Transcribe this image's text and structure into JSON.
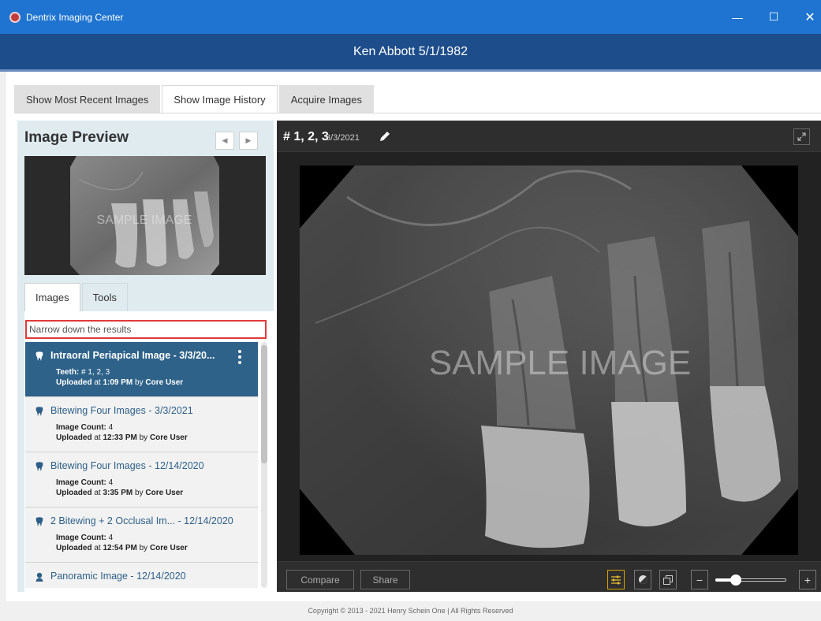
{
  "window": {
    "title": "Dentrix Imaging Center",
    "minimize": "—",
    "maximize": "☐",
    "close": "✕"
  },
  "patient": {
    "header": "Ken Abbott 5/1/1982"
  },
  "main_tabs": [
    {
      "label": "Show Most Recent Images",
      "active": false
    },
    {
      "label": "Show Image History",
      "active": true
    },
    {
      "label": "Acquire Images",
      "active": false
    }
  ],
  "preview": {
    "title": "Image Preview",
    "prev": "◀",
    "next": "▶",
    "watermark": "SAMPLE IMAGE"
  },
  "side_tabs": [
    {
      "label": "Images",
      "active": true
    },
    {
      "label": "Tools",
      "active": false
    }
  ],
  "filter": {
    "placeholder": "Narrow down the results",
    "value": ""
  },
  "results": [
    {
      "title": "Intraoral Periapical Image - 3/3/20...",
      "line1_label": "Teeth:",
      "line1_value": " # 1, 2, 3",
      "line2_label": "Uploaded",
      "line2_mid": " at ",
      "line2_time": "1:09 PM",
      "line2_by": " by ",
      "line2_user": "Core User",
      "selected": true,
      "icon": "tooth-icon"
    },
    {
      "title": "Bitewing Four Images - 3/3/2021",
      "line1_label": "Image Count:",
      "line1_value": " 4",
      "line2_label": "Uploaded",
      "line2_mid": " at ",
      "line2_time": "12:33 PM",
      "line2_by": " by ",
      "line2_user": "Core User",
      "selected": false,
      "icon": "tooth-icon"
    },
    {
      "title": "Bitewing Four Images - 12/14/2020",
      "line1_label": "Image Count:",
      "line1_value": " 4",
      "line2_label": "Uploaded",
      "line2_mid": " at ",
      "line2_time": "3:35 PM",
      "line2_by": " by ",
      "line2_user": "Core User",
      "selected": false,
      "icon": "tooth-icon"
    },
    {
      "title": "2 Bitewing + 2 Occlusal Im... - 12/14/2020",
      "line1_label": "Image Count:",
      "line1_value": " 4",
      "line2_label": "Uploaded",
      "line2_mid": " at ",
      "line2_time": "12:54 PM",
      "line2_by": " by ",
      "line2_user": "Core User",
      "selected": false,
      "icon": "tooth-icon"
    },
    {
      "title": "Panoramic Image - 12/14/2020",
      "line1_label": "",
      "line1_value": "",
      "line2_label": "",
      "line2_mid": "",
      "line2_time": "",
      "line2_by": "",
      "line2_user": "",
      "selected": false,
      "icon": "person-icon"
    }
  ],
  "viewer": {
    "teeth": "# 1, 2, 3",
    "date": "3/3/2021",
    "watermark": "SAMPLE IMAGE",
    "compare": "Compare",
    "share": "Share",
    "zoom_out": "−",
    "zoom_in": "+",
    "zoom_level": 0.25
  },
  "footer": {
    "copyright": "Copyright © 2013 - 2021 Henry Schein One | All Rights Reserved"
  },
  "colors": {
    "titlebar": "#1e74d0",
    "patient_header": "#1d4d8b",
    "selected_item": "#2e6289",
    "filter_border": "#e03a3a"
  }
}
